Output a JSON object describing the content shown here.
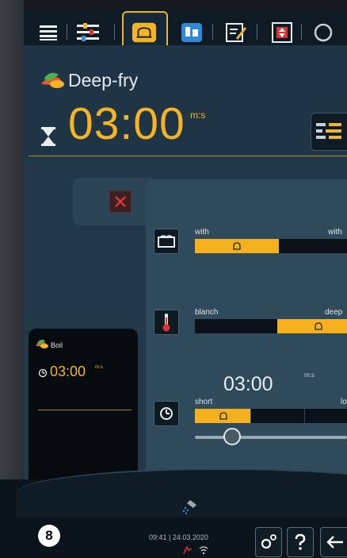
{
  "colors": {
    "accent": "#f3b526",
    "close": "#e03232",
    "background": "#22394a"
  },
  "topbar": {
    "icons": [
      "list-icon",
      "settings-sliders-icon",
      "cooking-mode-icon",
      "program-icon",
      "edit-icon",
      "steam-icon",
      "circle-icon"
    ],
    "active_icon": "cooking-mode-icon"
  },
  "header": {
    "mode": "Deep-fry",
    "timer": "03:00",
    "timer_unit": "m:s"
  },
  "sliders": {
    "moisture": {
      "left": "with",
      "right": "with",
      "level": 0.55
    },
    "temperature": {
      "left": "blanch",
      "right": "deep",
      "level": 0.78
    },
    "time": {
      "left": "short",
      "right": "lo",
      "level": 0.15
    }
  },
  "time_setting": {
    "value": "03:00",
    "unit": "m:s"
  },
  "mini_card": {
    "title": "Boil",
    "timer": "03:00",
    "unit": "m:s"
  },
  "footer": {
    "page": "8",
    "status": "09:41 | 24.03.2020"
  }
}
